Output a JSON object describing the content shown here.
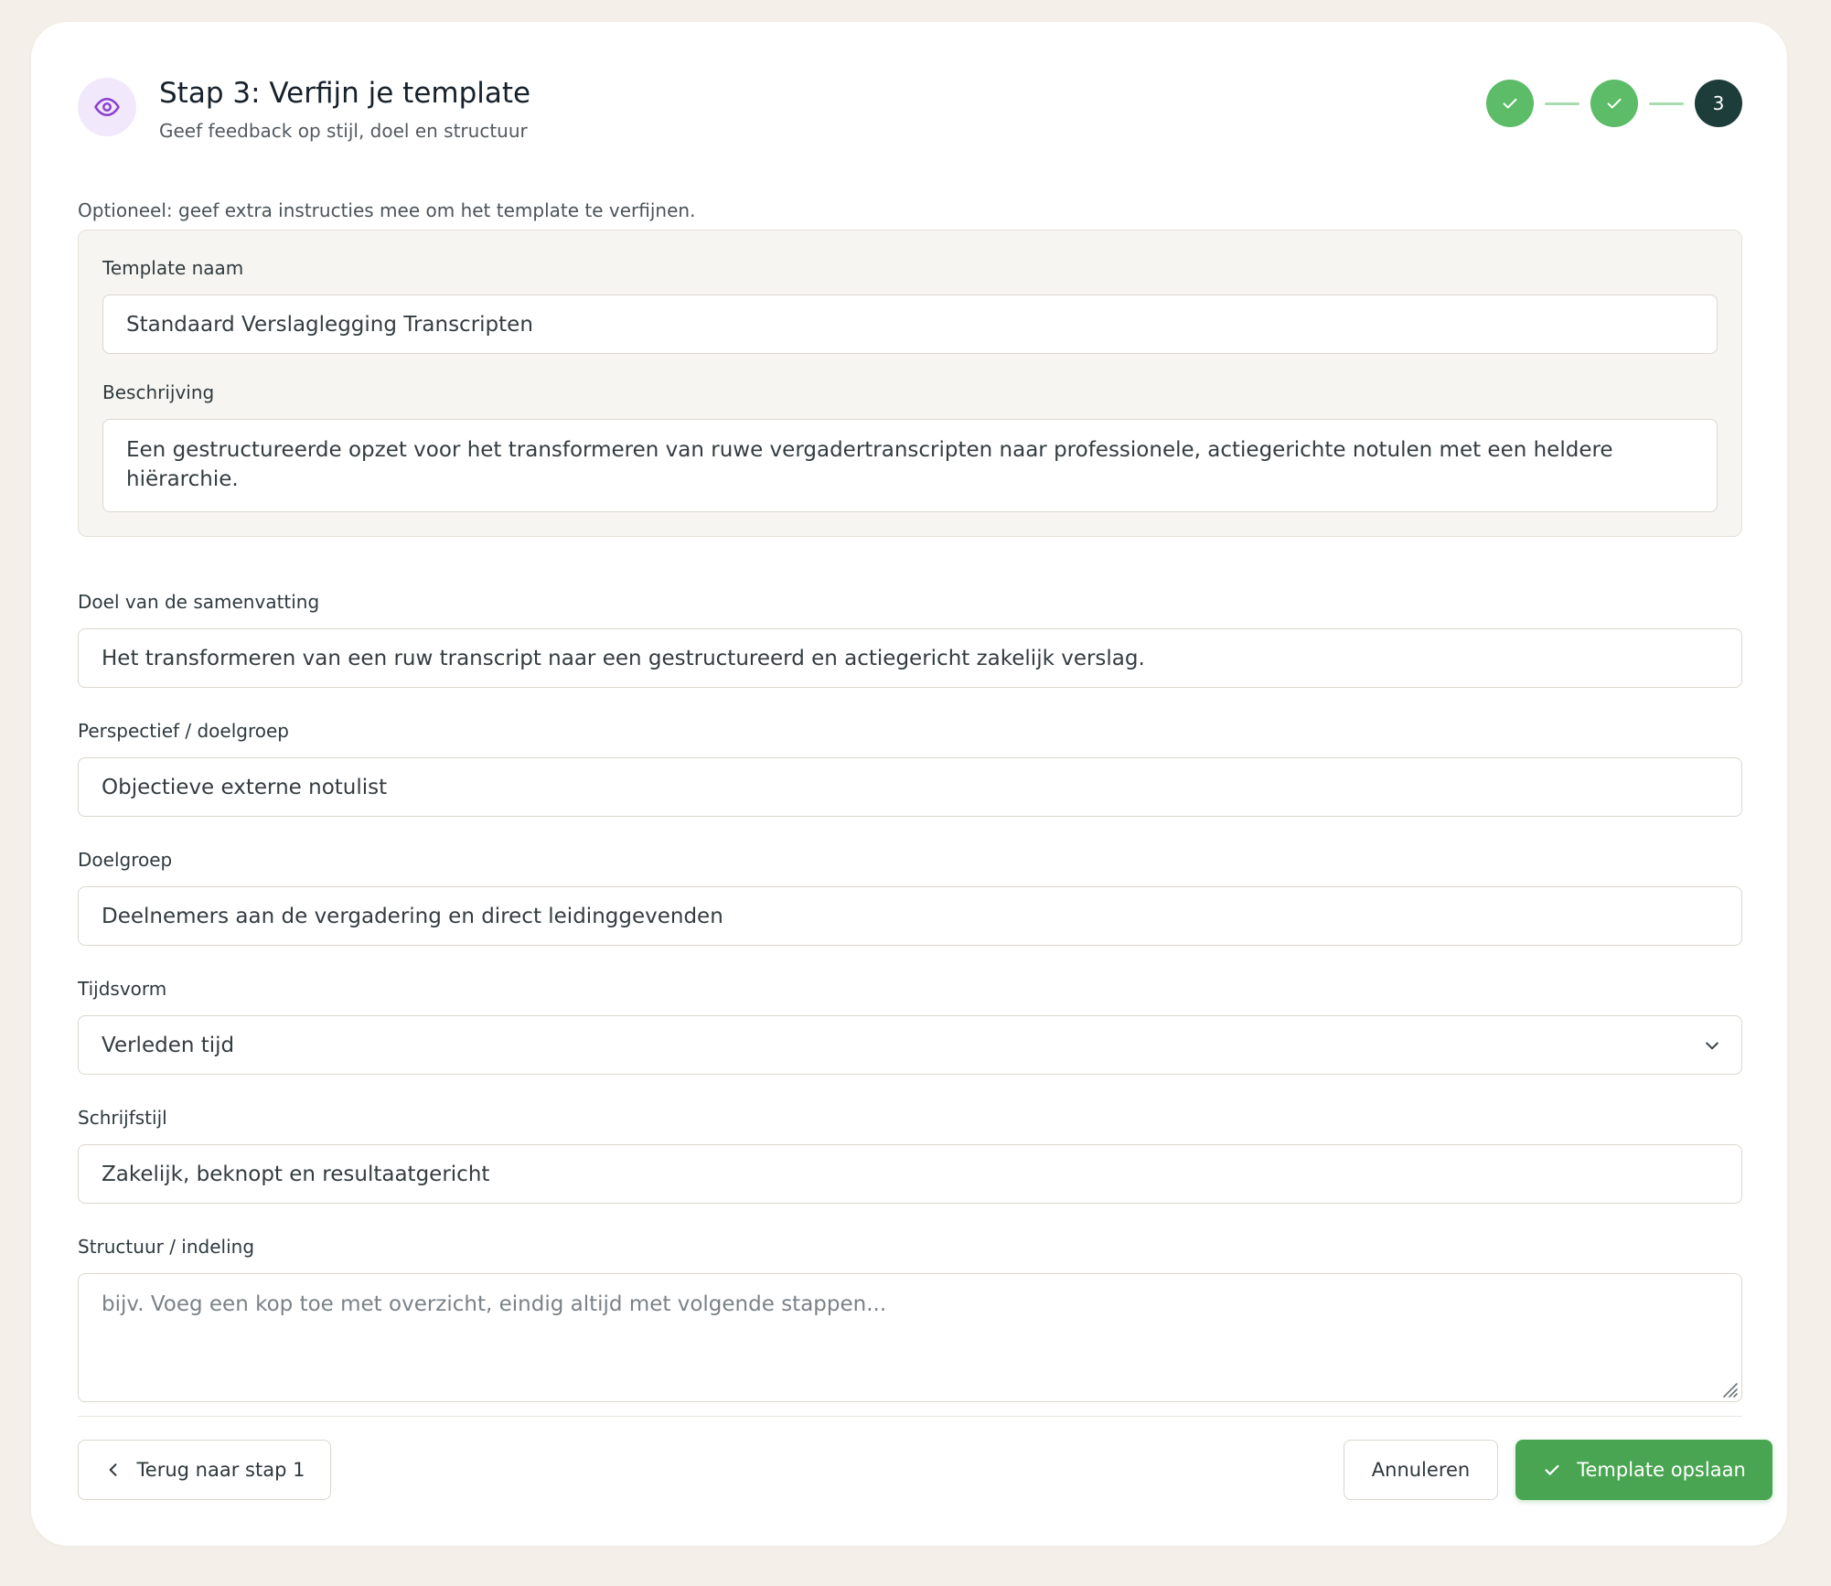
{
  "header": {
    "icon": "eye-icon",
    "title": "Stap 3: Verfijn je template",
    "subtitle": "Geef feedback op stijl, doel en structuur"
  },
  "stepper": {
    "steps": [
      {
        "state": "done",
        "icon": "check-icon"
      },
      {
        "state": "done",
        "icon": "check-icon"
      },
      {
        "state": "current",
        "label": "3"
      }
    ]
  },
  "hint": "Optioneel: geef extra instructies mee om het template te verfijnen.",
  "meta": {
    "name_label": "Template naam",
    "name_value": "Standaard Verslaglegging Transcripten",
    "description_label": "Beschrijving",
    "description_value": "Een gestructureerde opzet voor het transformeren van ruwe vergadertranscripten naar professionele, actiegerichte notulen met een heldere hiërarchie."
  },
  "fields": {
    "goal_label": "Doel van de samenvatting",
    "goal_value": "Het transformeren van een ruw transcript naar een gestructureerd en actiegericht zakelijk verslag.",
    "perspective_label": "Perspectief / doelgroep",
    "perspective_value": "Objectieve externe notulist",
    "audience_label": "Doelgroep",
    "audience_value": "Deelnemers aan de vergadering en direct leidinggevenden",
    "tense_label": "Tijdsvorm",
    "tense_value": "Verleden tijd",
    "style_label": "Schrijfstijl",
    "style_value": "Zakelijk, beknopt en resultaatgericht",
    "structure_label": "Structuur / indeling",
    "structure_placeholder": "bijv. Voeg een kop toe met overzicht, eindig altijd met volgende stappen..."
  },
  "footer": {
    "back_label": "Terug naar stap 1",
    "cancel_label": "Annuleren",
    "save_label": "Template opslaan"
  },
  "colors": {
    "accent_green": "#4aa552",
    "step_done": "#5cbc67",
    "step_current": "#1d3d3a",
    "icon_purple": "#8a3fd1",
    "page_bg": "#f4f0e9"
  }
}
